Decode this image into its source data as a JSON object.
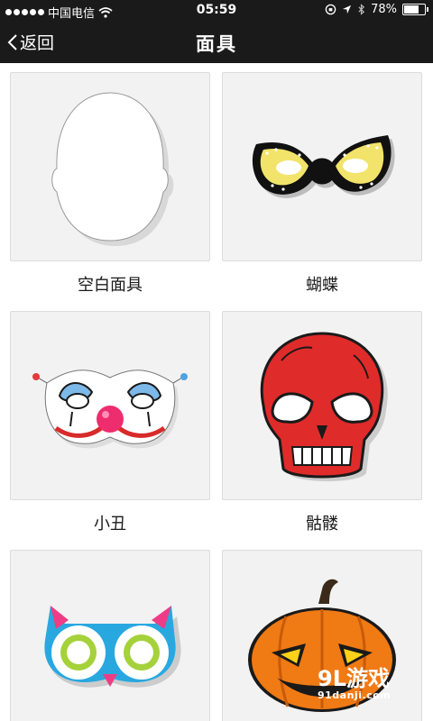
{
  "status": {
    "carrier": "中国电信",
    "time": "05:59",
    "battery": "78%",
    "battery_level": 0.78
  },
  "nav": {
    "back_label": "返回",
    "title": "面具"
  },
  "masks": [
    {
      "label": "空白面具",
      "icon": "blank-mask-icon"
    },
    {
      "label": "蝴蝶",
      "icon": "butterfly-mask-icon"
    },
    {
      "label": "小丑",
      "icon": "clown-mask-icon"
    },
    {
      "label": "骷髅",
      "icon": "skull-mask-icon"
    },
    {
      "label": "",
      "icon": "owl-mask-icon"
    },
    {
      "label": "",
      "icon": "pumpkin-mask-icon"
    }
  ],
  "watermark": {
    "brand": "9L游戏",
    "site": "91danji.com"
  }
}
